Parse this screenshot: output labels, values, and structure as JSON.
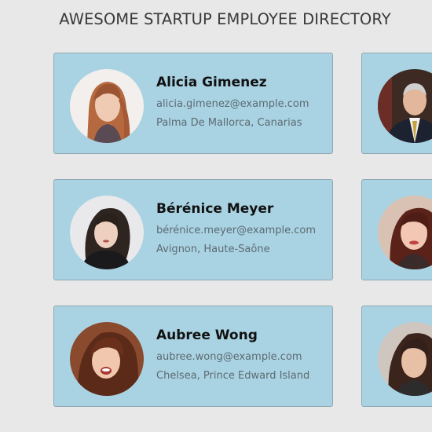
{
  "header": {
    "title": "AWESOME STARTUP EMPLOYEE DIRECTORY"
  },
  "employees": [
    {
      "name": "Alicia Gimenez",
      "email": "alicia.gimenez@example.com",
      "location": "Palma De Mallorca, Canarias",
      "avatar_icon": "woman-long-blonde-hair-photo"
    },
    {
      "name": "",
      "email": "",
      "location": "",
      "avatar_icon": "man-suit-tie-photo"
    },
    {
      "name": "Bérénice Meyer",
      "email": "bérénice.meyer@example.com",
      "location": "Avignon, Haute-Saône",
      "avatar_icon": "woman-dark-hair-photo"
    },
    {
      "name": "",
      "email": "",
      "location": "",
      "avatar_icon": "woman-red-hair-photo"
    },
    {
      "name": "Aubree Wong",
      "email": "aubree.wong@example.com",
      "location": "Chelsea, Prince Edward Island",
      "avatar_icon": "woman-smiling-brown-hair-photo"
    },
    {
      "name": "",
      "email": "",
      "location": "",
      "avatar_icon": "woman-long-dark-hair-photo"
    }
  ],
  "colors": {
    "card_background": "#a9d3e3",
    "page_background": "#e8e8e8"
  }
}
